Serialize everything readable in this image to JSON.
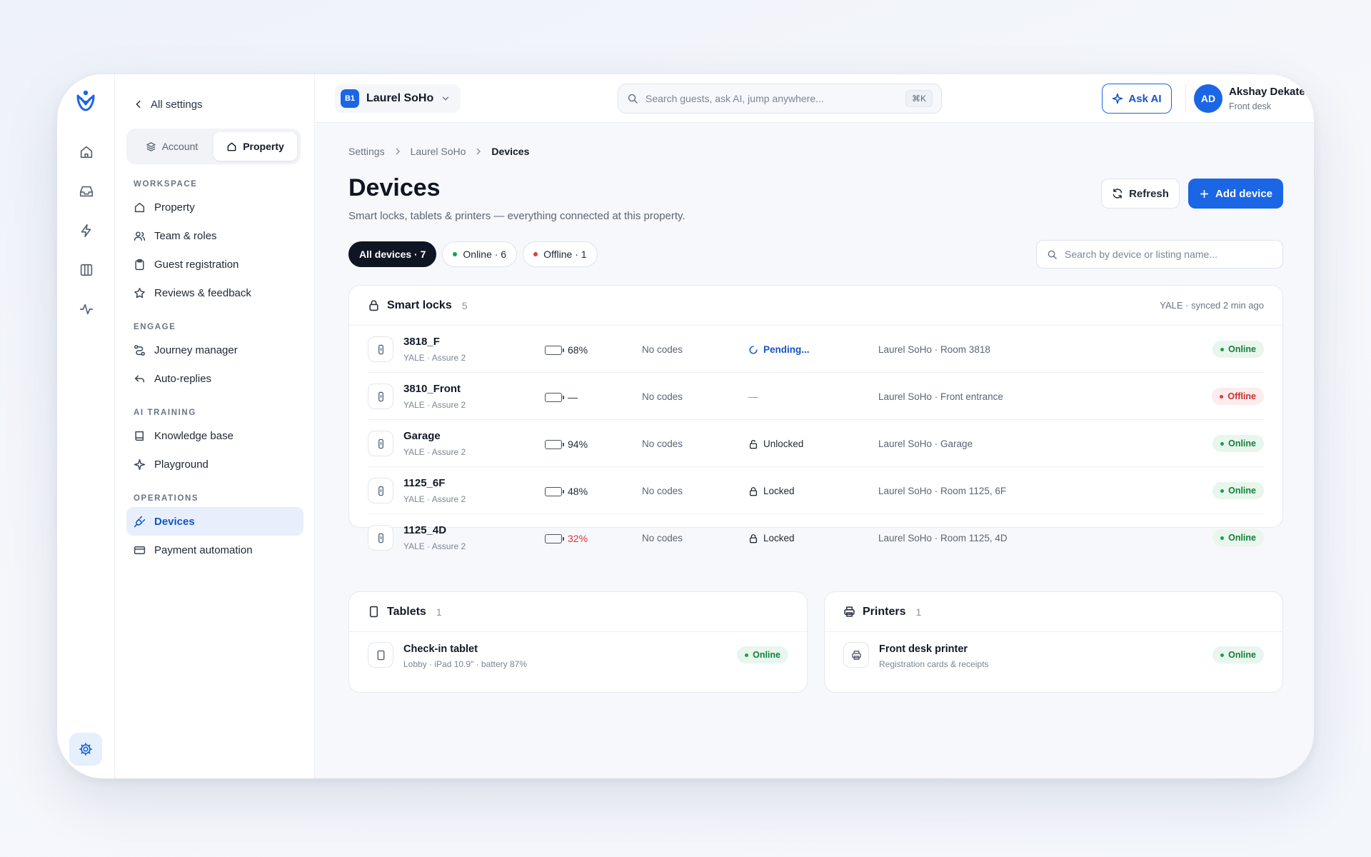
{
  "sidebar": {
    "back_label": "All settings",
    "tabs": [
      {
        "label": "Account",
        "icon": "layers-icon"
      },
      {
        "label": "Property",
        "icon": "home-icon"
      }
    ],
    "groups": {
      "workspace": "WORKSPACE",
      "engage": "ENGAGE",
      "ai_training": "AI TRAINING",
      "operations": "OPERATIONS"
    },
    "items": {
      "property": "Property",
      "team": "Team & roles",
      "guest_registration": "Guest registration",
      "reviews": "Reviews & feedback",
      "journey": "Journey manager",
      "auto_replies": "Auto-replies",
      "knowledge": "Knowledge base",
      "playground": "Playground",
      "devices": "Devices",
      "payment": "Payment automation"
    },
    "active_item": "Devices"
  },
  "topbar": {
    "property_badge": "B1",
    "property_name": "Laurel SoHo",
    "search_placeholder": "Search guests, ask AI, jump anywhere...",
    "search_shortcut": "⌘K",
    "ask_ai_label": "Ask AI",
    "user": {
      "initials": "AD",
      "name": "Akshay Dekate",
      "role": "Front desk"
    }
  },
  "breadcrumb": [
    "Settings",
    "Laurel SoHo",
    "Devices"
  ],
  "page": {
    "title": "Devices",
    "subtitle": "Smart locks, tablets & printers — everything connected at this property.",
    "refresh_label": "Refresh",
    "add_label": "Add device"
  },
  "filters": {
    "all": "All devices · 7",
    "online": "Online · 6",
    "offline": "Offline · 1",
    "search_placeholder": "Search by device or listing name..."
  },
  "colors": {
    "accent": "#1a66e5",
    "online": "#16a34a",
    "offline": "#e03a3a",
    "battery_good": "#16a34a",
    "battery_mid": "#e0a21a",
    "battery_low": "#d93636"
  },
  "smart_locks": {
    "title": "Smart locks",
    "count": "5",
    "sync_text": "YALE · synced 2 min ago",
    "rows": [
      {
        "name": "3818_F",
        "model": "YALE · Assure 2",
        "battery_pct": 68,
        "battery_text": "68%",
        "battery_level": "good",
        "codes": "No codes",
        "lock_state": "Pending...",
        "lock_kind": "pending",
        "location": "Laurel SoHo · Room 3818",
        "status": "Online",
        "status_kind": "online"
      },
      {
        "name": "3810_Front",
        "model": "YALE · Assure 2",
        "battery_pct": 0,
        "battery_text": "—",
        "battery_level": "none",
        "codes": "No codes",
        "lock_state": "—",
        "lock_kind": "none",
        "location": "Laurel SoHo · Front entrance",
        "status": "Offline",
        "status_kind": "offline"
      },
      {
        "name": "Garage",
        "model": "YALE · Assure 2",
        "battery_pct": 94,
        "battery_text": "94%",
        "battery_level": "good",
        "codes": "No codes",
        "lock_state": "Unlocked",
        "lock_kind": "unlocked",
        "location": "Laurel SoHo · Garage",
        "status": "Online",
        "status_kind": "online"
      },
      {
        "name": "1125_6F",
        "model": "YALE · Assure 2",
        "battery_pct": 48,
        "battery_text": "48%",
        "battery_level": "mid",
        "codes": "No codes",
        "lock_state": "Locked",
        "lock_kind": "locked",
        "location": "Laurel SoHo · Room 1125, 6F",
        "status": "Online",
        "status_kind": "online"
      },
      {
        "name": "1125_4D",
        "model": "YALE · Assure 2",
        "battery_pct": 32,
        "battery_text": "32%",
        "battery_level": "low",
        "codes": "No codes",
        "lock_state": "Locked",
        "lock_kind": "locked",
        "location": "Laurel SoHo · Room 1125, 4D",
        "status": "Online",
        "status_kind": "online"
      }
    ]
  },
  "tablets": {
    "title": "Tablets",
    "count": "1",
    "item": {
      "name": "Check-in tablet",
      "detail": "Lobby · iPad 10.9\" · battery 87%",
      "status": "Online"
    }
  },
  "printers": {
    "title": "Printers",
    "count": "1",
    "item": {
      "name": "Front desk printer",
      "detail": "Registration cards & receipts",
      "status": "Online"
    }
  }
}
